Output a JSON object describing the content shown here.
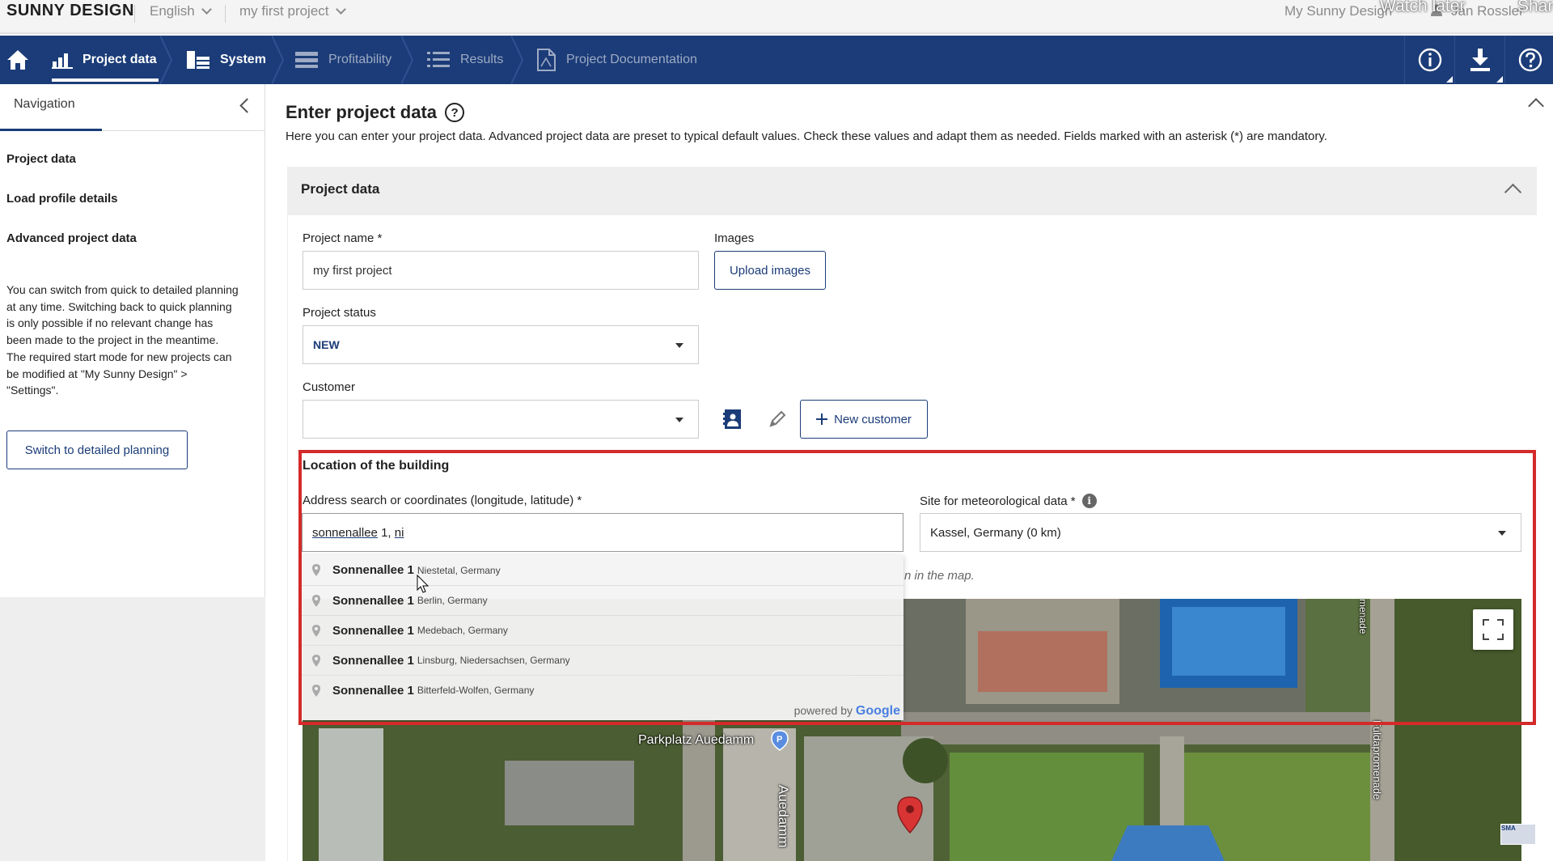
{
  "topbar": {
    "logo": "SUNNY DESIGN",
    "language": "English",
    "project": "my first project",
    "my_sunny_design": "My Sunny Design",
    "watch_later": "Watch later",
    "share": "Share",
    "user": "Jan Rossler"
  },
  "mainnav": {
    "tabs": [
      {
        "label": "Project data",
        "icon": "bar-chart-icon"
      },
      {
        "label": "System",
        "icon": "system-icon"
      },
      {
        "label": "Profitability",
        "icon": "profitability-icon"
      },
      {
        "label": "Results",
        "icon": "list-icon"
      },
      {
        "label": "Project Documentation",
        "icon": "document-icon"
      }
    ],
    "active_color": "#ffffff",
    "bar_color": "#1b3c78"
  },
  "sidebar": {
    "heading": "Navigation",
    "links": [
      "Project data",
      "Load profile details",
      "Advanced project data"
    ],
    "info_text": "You can switch from quick to detailed planning at any time. Switching back to quick planning is only possible if no relevant change has been made to the project in the meantime. The required start mode for new projects can be modified at \"My Sunny Design\" > \"Settings\".",
    "switch_button": "Switch to detailed planning"
  },
  "page": {
    "title": "Enter project data",
    "description": "Here you can enter your project data. Advanced project data are preset to typical default values. Check these values and adapt them as needed. Fields marked with an asterisk (*) are mandatory."
  },
  "project_panel": {
    "heading": "Project data",
    "name_label": "Project name *",
    "name_value": "my first project",
    "images_label": "Images",
    "upload_button": "Upload images",
    "status_label": "Project status",
    "status_value": "NEW",
    "customer_label": "Customer",
    "customer_value": "",
    "new_customer_button": "New customer"
  },
  "location": {
    "heading": "Location of the building",
    "address_label": "Address search or coordinates (longitude, latitude) *",
    "address_value_underlined": "sonnenallee",
    "address_value_rest": " 1, ",
    "address_value_tail": "ni",
    "met_label": "Site for meteorological data *",
    "met_value": "Kassel, Germany (0 km)",
    "map_hint": "n in the map.",
    "suggestions": [
      {
        "main": "Sonnenallee 1",
        "sub": "Niestetal, Germany"
      },
      {
        "main": "Sonnenallee 1",
        "sub": "Berlin, Germany"
      },
      {
        "main": "Sonnenallee 1",
        "sub": "Medebach, Germany"
      },
      {
        "main": "Sonnenallee 1",
        "sub": "Linsburg, Niedersachsen, Germany"
      },
      {
        "main": "Sonnenallee 1",
        "sub": "Bitterfeld-Wolfen, Germany"
      }
    ],
    "powered_by": "powered by",
    "google": "Google",
    "highlight_color": "#d42a2a"
  },
  "map": {
    "parking_label": "Parkplatz Auedamm",
    "road_label_1": "Auedamm",
    "road_label_2": "Fuldapromenade",
    "road_label_3": "menade",
    "badge": "SMA"
  }
}
